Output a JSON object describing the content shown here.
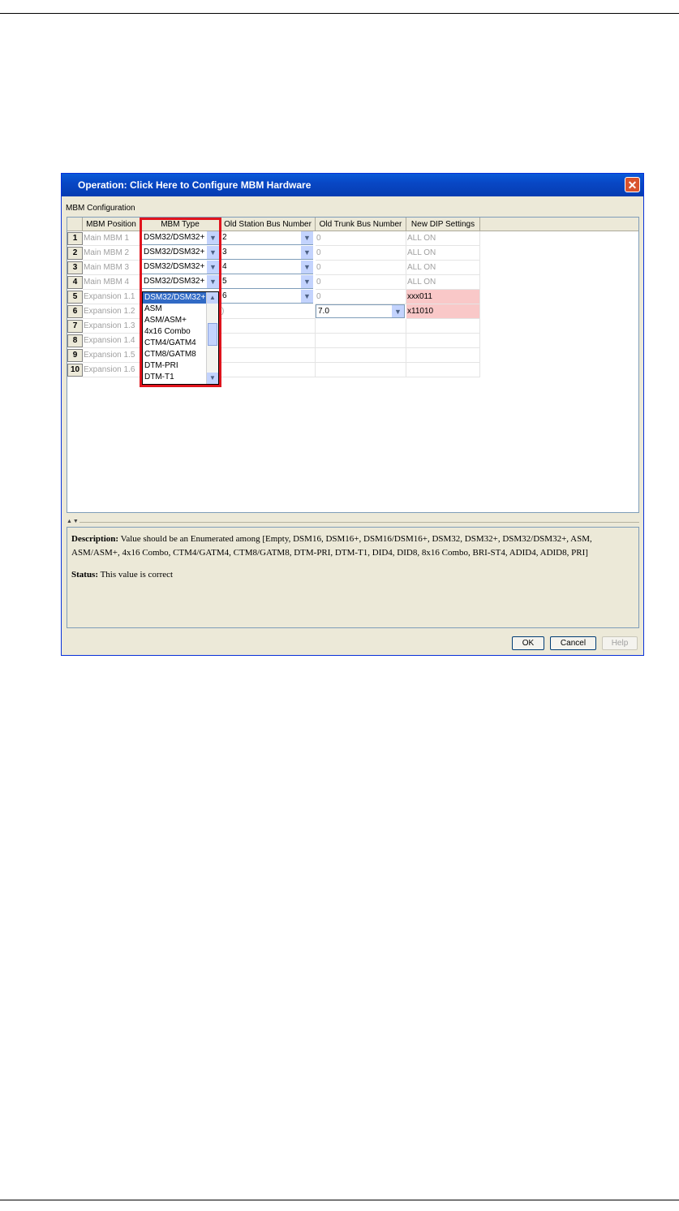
{
  "dialog": {
    "title": "Operation: Click Here to Configure MBM Hardware",
    "close_glyph": "✕",
    "group_label": "MBM Configuration"
  },
  "table": {
    "headers": [
      "MBM Position",
      "MBM Type",
      "Old Station Bus Number",
      "Old Trunk Bus Number",
      "New DIP Settings"
    ],
    "rows": [
      {
        "num": "1",
        "position": "Main MBM  1",
        "type": "DSM32/DSM32+",
        "station": "2",
        "trunk": "0",
        "dip": "ALL ON"
      },
      {
        "num": "2",
        "position": "Main MBM  2",
        "type": "DSM32/DSM32+",
        "station": "3",
        "trunk": "0",
        "dip": "ALL ON"
      },
      {
        "num": "3",
        "position": "Main MBM  3",
        "type": "DSM32/DSM32+",
        "station": "4",
        "trunk": "0",
        "dip": "ALL ON"
      },
      {
        "num": "4",
        "position": "Main MBM  4",
        "type": "DSM32/DSM32+",
        "station": "5",
        "trunk": "0",
        "dip": "ALL ON"
      },
      {
        "num": "5",
        "position": "Expansion 1.1",
        "type": "",
        "station": "6",
        "trunk": "0",
        "dip": "xxx011"
      },
      {
        "num": "6",
        "position": "Expansion 1.2",
        "type": "",
        "station": ")",
        "trunk": "7.0",
        "dip": "x11010"
      },
      {
        "num": "7",
        "position": "Expansion 1.3",
        "type": "",
        "station": "",
        "trunk": "",
        "dip": ""
      },
      {
        "num": "8",
        "position": "Expansion 1.4",
        "type": "",
        "station": "",
        "trunk": "",
        "dip": ""
      },
      {
        "num": "9",
        "position": "Expansion 1.5",
        "type": "",
        "station": "",
        "trunk": "",
        "dip": ""
      },
      {
        "num": "10",
        "position": "Expansion 1.6",
        "type": "",
        "station": "",
        "trunk": "",
        "dip": ""
      }
    ]
  },
  "dropdown": {
    "options": [
      "DSM32/DSM32+",
      "ASM",
      "ASM/ASM+",
      "4x16 Combo",
      "CTM4/GATM4",
      "CTM8/GATM8",
      "DTM-PRI",
      "DTM-T1"
    ],
    "selected": "DSM32/DSM32+"
  },
  "splitter_glyph": "▲▼",
  "description": {
    "label": "Description:",
    "text": "Value should be an Enumerated among [Empty, DSM16, DSM16+, DSM16/DSM16+, DSM32, DSM32+, DSM32/DSM32+, ASM, ASM/ASM+, 4x16 Combo, CTM4/GATM4, CTM8/GATM8, DTM-PRI, DTM-T1, DID4, DID8, 8x16 Combo, BRI-ST4, ADID4, ADID8, PRI]",
    "status_label": "Status:",
    "status_text": "This value is correct"
  },
  "buttons": {
    "ok": "OK",
    "cancel": "Cancel",
    "help": "Help"
  },
  "icons": {
    "dropdown_arrow": "chevron-down-icon",
    "scroll_up": "arrow-up-icon",
    "scroll_down": "arrow-down-icon",
    "close": "close-icon"
  }
}
